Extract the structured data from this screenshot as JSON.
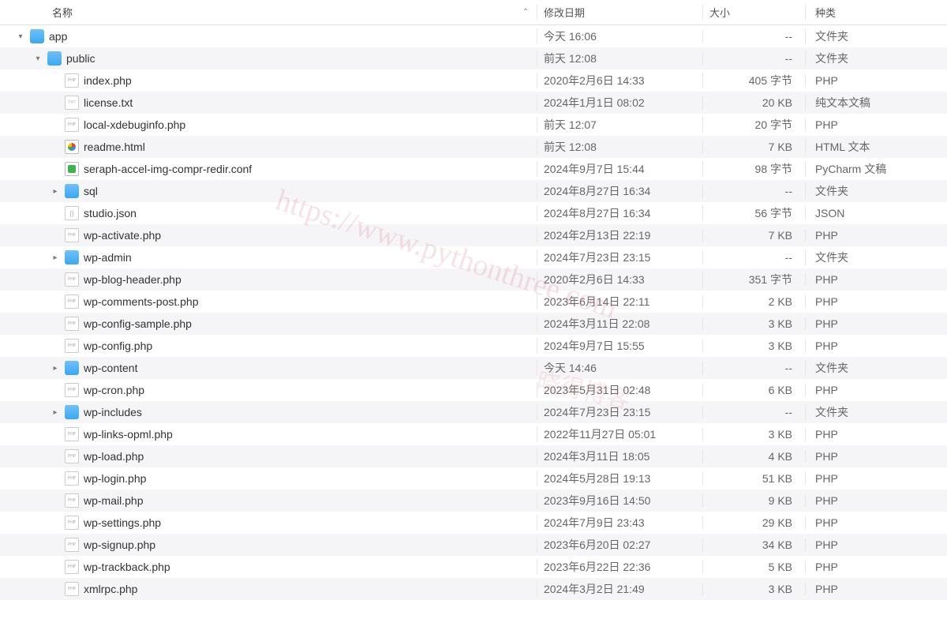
{
  "header": {
    "name": "名称",
    "date": "修改日期",
    "size": "大小",
    "kind": "种类"
  },
  "watermark_url": "https://www.pythonthree.com",
  "watermark_text": "晓得博客",
  "rows": [
    {
      "indent": 0,
      "disclosure": "down",
      "icon": "folder",
      "name": "app",
      "date": "今天 16:06",
      "size": "--",
      "kind": "文件夹"
    },
    {
      "indent": 1,
      "disclosure": "down",
      "icon": "folder",
      "name": "public",
      "date": "前天 12:08",
      "size": "--",
      "kind": "文件夹"
    },
    {
      "indent": 2,
      "disclosure": "",
      "icon": "file php",
      "name": "index.php",
      "date": "2020年2月6日 14:33",
      "size": "405 字节",
      "kind": "PHP"
    },
    {
      "indent": 2,
      "disclosure": "",
      "icon": "file txt",
      "name": "license.txt",
      "date": "2024年1月1日 08:02",
      "size": "20 KB",
      "kind": "纯文本文稿"
    },
    {
      "indent": 2,
      "disclosure": "",
      "icon": "file php",
      "name": "local-xdebuginfo.php",
      "date": "前天 12:07",
      "size": "20 字节",
      "kind": "PHP"
    },
    {
      "indent": 2,
      "disclosure": "",
      "icon": "file html",
      "name": "readme.html",
      "date": "前天 12:08",
      "size": "7 KB",
      "kind": "HTML 文本"
    },
    {
      "indent": 2,
      "disclosure": "",
      "icon": "file conf",
      "name": "seraph-accel-img-compr-redir.conf",
      "date": "2024年9月7日 15:44",
      "size": "98 字节",
      "kind": "PyCharm 文稿"
    },
    {
      "indent": 2,
      "disclosure": "right",
      "icon": "folder",
      "name": "sql",
      "date": "2024年8月27日 16:34",
      "size": "--",
      "kind": "文件夹"
    },
    {
      "indent": 2,
      "disclosure": "",
      "icon": "file json",
      "name": "studio.json",
      "date": "2024年8月27日 16:34",
      "size": "56 字节",
      "kind": "JSON"
    },
    {
      "indent": 2,
      "disclosure": "",
      "icon": "file php",
      "name": "wp-activate.php",
      "date": "2024年2月13日 22:19",
      "size": "7 KB",
      "kind": "PHP"
    },
    {
      "indent": 2,
      "disclosure": "right",
      "icon": "folder",
      "name": "wp-admin",
      "date": "2024年7月23日 23:15",
      "size": "--",
      "kind": "文件夹"
    },
    {
      "indent": 2,
      "disclosure": "",
      "icon": "file php",
      "name": "wp-blog-header.php",
      "date": "2020年2月6日 14:33",
      "size": "351 字节",
      "kind": "PHP"
    },
    {
      "indent": 2,
      "disclosure": "",
      "icon": "file php",
      "name": "wp-comments-post.php",
      "date": "2023年6月14日 22:11",
      "size": "2 KB",
      "kind": "PHP"
    },
    {
      "indent": 2,
      "disclosure": "",
      "icon": "file php",
      "name": "wp-config-sample.php",
      "date": "2024年3月11日 22:08",
      "size": "3 KB",
      "kind": "PHP"
    },
    {
      "indent": 2,
      "disclosure": "",
      "icon": "file php",
      "name": "wp-config.php",
      "date": "2024年9月7日 15:55",
      "size": "3 KB",
      "kind": "PHP"
    },
    {
      "indent": 2,
      "disclosure": "right",
      "icon": "folder",
      "name": "wp-content",
      "date": "今天 14:46",
      "size": "--",
      "kind": "文件夹"
    },
    {
      "indent": 2,
      "disclosure": "",
      "icon": "file php",
      "name": "wp-cron.php",
      "date": "2023年5月31日 02:48",
      "size": "6 KB",
      "kind": "PHP"
    },
    {
      "indent": 2,
      "disclosure": "right",
      "icon": "folder",
      "name": "wp-includes",
      "date": "2024年7月23日 23:15",
      "size": "--",
      "kind": "文件夹"
    },
    {
      "indent": 2,
      "disclosure": "",
      "icon": "file php",
      "name": "wp-links-opml.php",
      "date": "2022年11月27日 05:01",
      "size": "3 KB",
      "kind": "PHP"
    },
    {
      "indent": 2,
      "disclosure": "",
      "icon": "file php",
      "name": "wp-load.php",
      "date": "2024年3月11日 18:05",
      "size": "4 KB",
      "kind": "PHP"
    },
    {
      "indent": 2,
      "disclosure": "",
      "icon": "file php",
      "name": "wp-login.php",
      "date": "2024年5月28日 19:13",
      "size": "51 KB",
      "kind": "PHP"
    },
    {
      "indent": 2,
      "disclosure": "",
      "icon": "file php",
      "name": "wp-mail.php",
      "date": "2023年9月16日 14:50",
      "size": "9 KB",
      "kind": "PHP"
    },
    {
      "indent": 2,
      "disclosure": "",
      "icon": "file php",
      "name": "wp-settings.php",
      "date": "2024年7月9日 23:43",
      "size": "29 KB",
      "kind": "PHP"
    },
    {
      "indent": 2,
      "disclosure": "",
      "icon": "file php",
      "name": "wp-signup.php",
      "date": "2023年6月20日 02:27",
      "size": "34 KB",
      "kind": "PHP"
    },
    {
      "indent": 2,
      "disclosure": "",
      "icon": "file php",
      "name": "wp-trackback.php",
      "date": "2023年6月22日 22:36",
      "size": "5 KB",
      "kind": "PHP"
    },
    {
      "indent": 2,
      "disclosure": "",
      "icon": "file php",
      "name": "xmlrpc.php",
      "date": "2024年3月2日 21:49",
      "size": "3 KB",
      "kind": "PHP"
    }
  ]
}
